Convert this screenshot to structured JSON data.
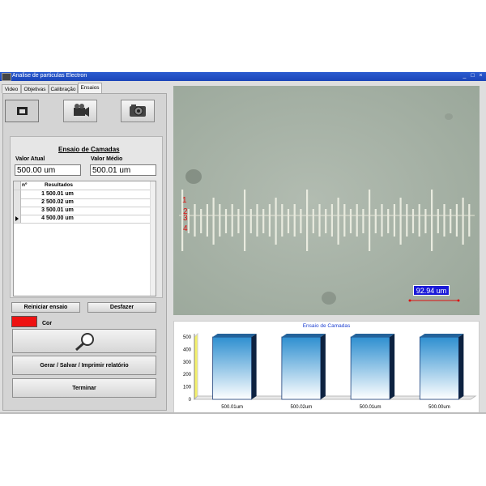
{
  "window": {
    "title": "Analise de particulas Electron",
    "controls": [
      "_",
      "□",
      "×"
    ]
  },
  "tabs": [
    "Video",
    "Objetivas",
    "Calibração",
    "Ensaios"
  ],
  "active_tab": "Ensaios",
  "toolbar": {
    "buttons": [
      "monitor-icon",
      "video-camera-icon",
      "photo-camera-icon"
    ]
  },
  "test_panel": {
    "title": "Ensaio de Camadas",
    "current_label": "Valor Atual",
    "current_value": "500.00 um",
    "average_label": "Valor Médio",
    "average_value": "500.01 um",
    "columns": [
      "nº",
      "Resultados"
    ],
    "rows": [
      {
        "n": "1",
        "result": "500.01 um"
      },
      {
        "n": "2",
        "result": "500.02 um"
      },
      {
        "n": "3",
        "result": "500.01 um"
      },
      {
        "n": "4",
        "result": "500.00 um"
      }
    ],
    "selected_row": 3
  },
  "buttons": {
    "restart": "Reiniciar ensaio",
    "undo": "Desfazer",
    "color_label": "Cor",
    "color": "#ee1111",
    "report": "Gerar / Salvar / Imprimir relatório",
    "finish": "Terminar"
  },
  "micrograph": {
    "markers": [
      "1",
      "2",
      "3",
      "4"
    ],
    "measurement_label": "92.94 um",
    "colors": {
      "background": "#a7b3a8",
      "markers": "#dd1111",
      "label_bg": "#1a1ad8"
    }
  },
  "chart_data": {
    "type": "bar",
    "title": "Ensaio de Camadas",
    "categories": [
      "500.01um",
      "500.02um",
      "500.01um",
      "500.00um"
    ],
    "values": [
      500.01,
      500.02,
      500.01,
      500.0
    ],
    "ylim": [
      0,
      500
    ],
    "yticks": [
      0,
      100,
      200,
      300,
      400,
      500
    ],
    "grid": false,
    "legend": "none",
    "bar_color": "#3aa7dc"
  }
}
